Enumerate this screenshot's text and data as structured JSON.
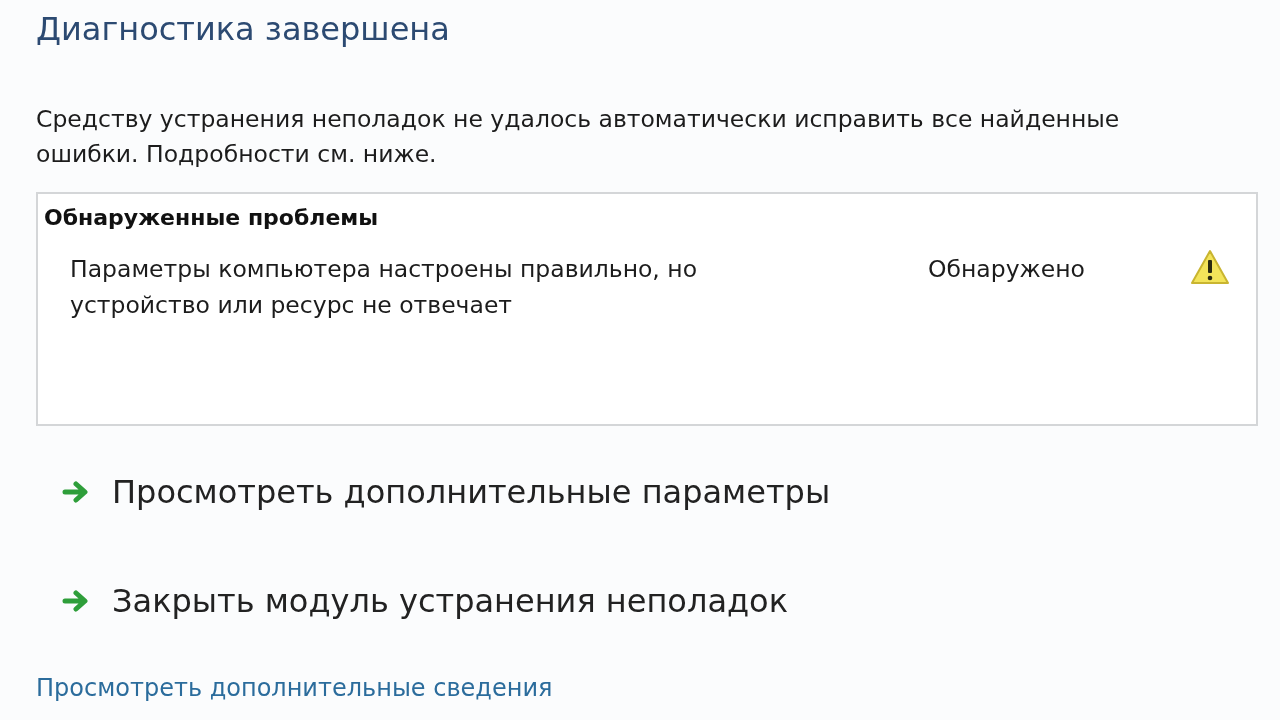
{
  "title": "Диагностика завершена",
  "message": "Средству устранения неполадок не удалось автоматически исправить все найденные ошибки. Подробности см. ниже.",
  "problems": {
    "heading": "Обнаруженные проблемы",
    "items": [
      {
        "description": "Параметры компьютера настроены правильно, но устройство или ресурс не отвечает",
        "status": "Обнаружено",
        "kind": "warning"
      }
    ]
  },
  "actions": [
    {
      "label": "Просмотреть дополнительные параметры"
    },
    {
      "label": "Закрыть модуль устранения неполадок"
    }
  ],
  "details_link": "Просмотреть дополнительные сведения"
}
